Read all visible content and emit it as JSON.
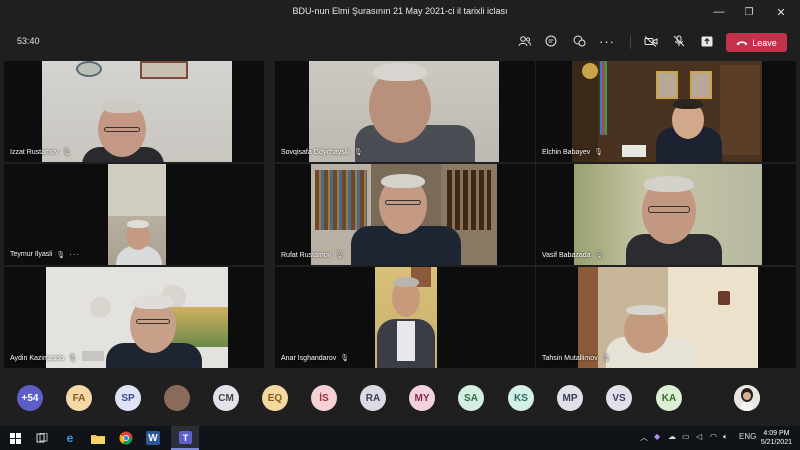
{
  "window": {
    "title": "BDU-nun Elmi Şurasının 21 May 2021-ci il tarixli iclası",
    "minimize": "—",
    "maximize": "❐",
    "close": "✕"
  },
  "meeting": {
    "timer": "53:40",
    "leave_label": "Leave",
    "icons": [
      "people-icon",
      "chat-icon",
      "reactions-icon",
      "more-icon",
      "camera-off-icon",
      "mic-off-icon",
      "share-icon"
    ]
  },
  "participants": [
    {
      "name": "Izzat Rustamov"
    },
    {
      "name": "Sovqisafa Goychayski"
    },
    {
      "name": "Elchin Babayev"
    },
    {
      "name": "Teymur Ilyasli"
    },
    {
      "name": "Rufat Rustamov"
    },
    {
      "name": "Vasif Babazada"
    },
    {
      "name": "Aydin Kazimzada"
    },
    {
      "name": "Anar Isghandarov"
    },
    {
      "name": "Tahsin Mutallimov"
    }
  ],
  "roster": {
    "overflow": "+54",
    "initials": [
      "FA",
      "SP",
      "",
      "CM",
      "EQ",
      "İS",
      "RA",
      "MY",
      "SA",
      "KS",
      "MP",
      "VS",
      "KA"
    ]
  },
  "taskbar": {
    "language": "ENG",
    "time": "4:09 PM",
    "date": "5/21/2021"
  },
  "colors": {
    "leave": "#c4314b",
    "background": "#1f1f1f"
  }
}
